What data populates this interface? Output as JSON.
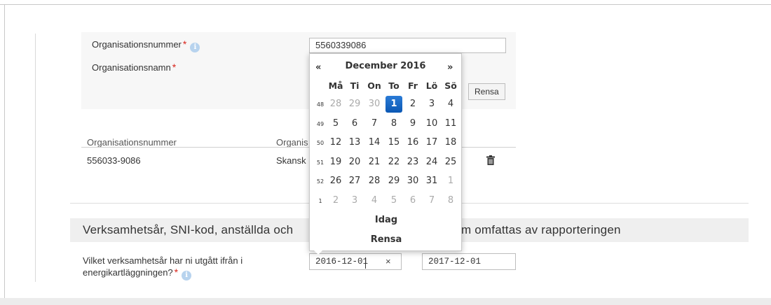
{
  "org_form": {
    "orgnr_label": "Organisationsnummer",
    "orgname_label": "Organisationsnamn",
    "required_mark": "*",
    "info_glyph": "i",
    "orgnr_value": "5560339086",
    "clear_button": "Rensa"
  },
  "org_table": {
    "headers": [
      "Organisationsnummer",
      "Organis"
    ],
    "rows": [
      {
        "orgnr": "556033-9086",
        "name": "Skansk"
      }
    ]
  },
  "section": {
    "title_left": "Verksamhetsår, SNI-kod, anställda och",
    "title_right": "om omfattas av rapporteringen"
  },
  "fiscal_year": {
    "question_line1": "Vilket verksamhetsår har ni utgått ifrån i",
    "question_line2": "energikartläggningen?",
    "start_value": "2016-12-01",
    "end_value": "2017-12-01",
    "clear_glyph": "×"
  },
  "datepicker": {
    "prev": "«",
    "next": "»",
    "title": "December 2016",
    "weekdays": [
      "Må",
      "Ti",
      "On",
      "To",
      "Fr",
      "Lö",
      "Sö"
    ],
    "weeks": [
      {
        "num": "48",
        "days": [
          {
            "d": "28",
            "m": true
          },
          {
            "d": "29",
            "m": true
          },
          {
            "d": "30",
            "m": true
          },
          {
            "d": "1",
            "sel": true
          },
          {
            "d": "2"
          },
          {
            "d": "3"
          },
          {
            "d": "4"
          }
        ]
      },
      {
        "num": "49",
        "days": [
          {
            "d": "5"
          },
          {
            "d": "6"
          },
          {
            "d": "7"
          },
          {
            "d": "8"
          },
          {
            "d": "9"
          },
          {
            "d": "10"
          },
          {
            "d": "11"
          }
        ]
      },
      {
        "num": "50",
        "days": [
          {
            "d": "12"
          },
          {
            "d": "13"
          },
          {
            "d": "14"
          },
          {
            "d": "15"
          },
          {
            "d": "16"
          },
          {
            "d": "17"
          },
          {
            "d": "18"
          }
        ]
      },
      {
        "num": "51",
        "days": [
          {
            "d": "19"
          },
          {
            "d": "20"
          },
          {
            "d": "21"
          },
          {
            "d": "22"
          },
          {
            "d": "23"
          },
          {
            "d": "24"
          },
          {
            "d": "25"
          }
        ]
      },
      {
        "num": "52",
        "days": [
          {
            "d": "26"
          },
          {
            "d": "27"
          },
          {
            "d": "28"
          },
          {
            "d": "29"
          },
          {
            "d": "30"
          },
          {
            "d": "31"
          },
          {
            "d": "1",
            "m": true
          }
        ]
      },
      {
        "num": "1",
        "days": [
          {
            "d": "2",
            "m": true
          },
          {
            "d": "3",
            "m": true
          },
          {
            "d": "4",
            "m": true
          },
          {
            "d": "5",
            "m": true
          },
          {
            "d": "6",
            "m": true
          },
          {
            "d": "7",
            "m": true
          },
          {
            "d": "8",
            "m": true
          }
        ]
      }
    ],
    "today_label": "Idag",
    "clear_label": "Rensa"
  }
}
